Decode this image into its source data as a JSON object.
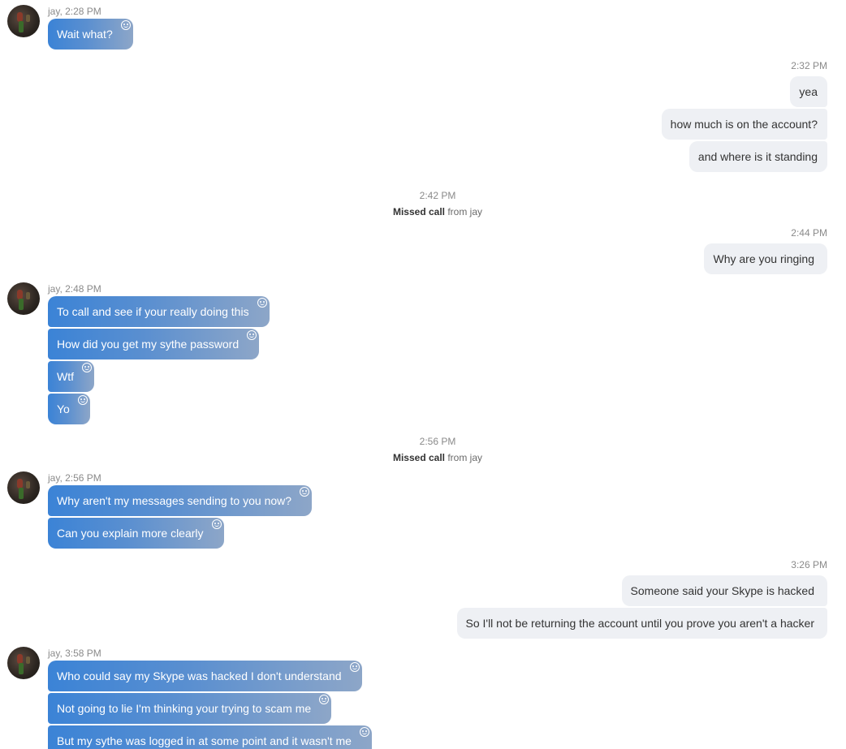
{
  "conversation": {
    "g1": {
      "meta": "jay, 2:28 PM",
      "messages": [
        "Wait what?"
      ]
    },
    "o1": {
      "time": "2:32 PM",
      "messages": [
        "yea",
        "how much is on the account?",
        "and where is it standing"
      ]
    },
    "s1": {
      "time": "2:42 PM",
      "bold": "Missed call",
      "rest": "from jay"
    },
    "o2": {
      "time": "2:44 PM",
      "messages": [
        "Why are you ringing"
      ]
    },
    "g2": {
      "meta": "jay, 2:48 PM",
      "messages": [
        "To call and see if your really doing this",
        "How did you get my sythe password",
        "Wtf",
        "Yo"
      ]
    },
    "s2": {
      "time": "2:56 PM",
      "bold": "Missed call",
      "rest": "from jay"
    },
    "g3": {
      "meta": "jay, 2:56 PM",
      "messages": [
        "Why aren't my messages sending to you now?",
        "Can you explain more clearly"
      ]
    },
    "o3": {
      "time": "3:26 PM",
      "messages": [
        "Someone said your Skype is hacked",
        "So I'll not be returning the account until you prove you aren't a hacker"
      ]
    },
    "g4": {
      "meta": "jay, 3:58 PM",
      "messages": [
        "Who could say my Skype was hacked I don't understand",
        "Not going to lie I'm thinking your trying to scam me",
        "But my sythe was logged in at some point and it wasn't me"
      ]
    }
  },
  "colors": {
    "incoming_gradient_start": "#3b83d6",
    "incoming_gradient_end": "#8da6c8",
    "outgoing_bg": "#eef0f4",
    "timestamp": "#8a8a8a"
  },
  "icons": {
    "reaction": "smiley-face-icon",
    "avatar": "user-avatar"
  }
}
